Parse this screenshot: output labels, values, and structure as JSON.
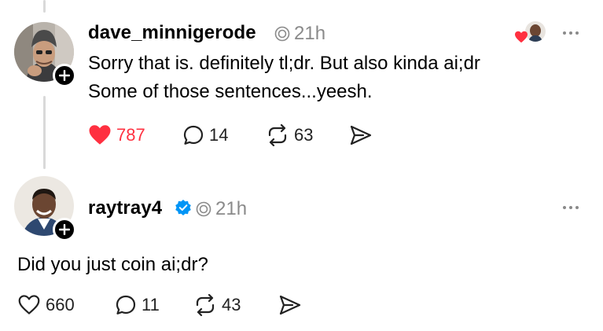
{
  "posts": [
    {
      "username": "dave_minnigerode",
      "time": "21h",
      "verified": false,
      "text_lines": [
        "Sorry that is.  definitely tl;dr.  But also kinda ai;dr",
        "Some of those sentences...yeesh."
      ],
      "liked": true,
      "likes": "787",
      "replies": "14",
      "reposts": "63",
      "icons": {
        "like": "heart-filled-icon",
        "reply": "speech-bubble-icon",
        "repost": "repost-icon",
        "share": "send-icon",
        "menu": "more-horizontal-icon"
      },
      "liked_by_author_indicator": true
    },
    {
      "username": "raytray4",
      "time": "21h",
      "verified": true,
      "text_lines": [
        "Did you just coin ai;dr?"
      ],
      "liked": false,
      "likes": "660",
      "replies": "11",
      "reposts": "43",
      "icons": {
        "like": "heart-outline-icon",
        "reply": "speech-bubble-icon",
        "repost": "repost-icon",
        "share": "send-icon",
        "menu": "more-horizontal-icon"
      }
    }
  ],
  "colors": {
    "like_red": "#ff3040",
    "verified_blue": "#0095f6",
    "meta_gray": "#8a8a8a"
  }
}
